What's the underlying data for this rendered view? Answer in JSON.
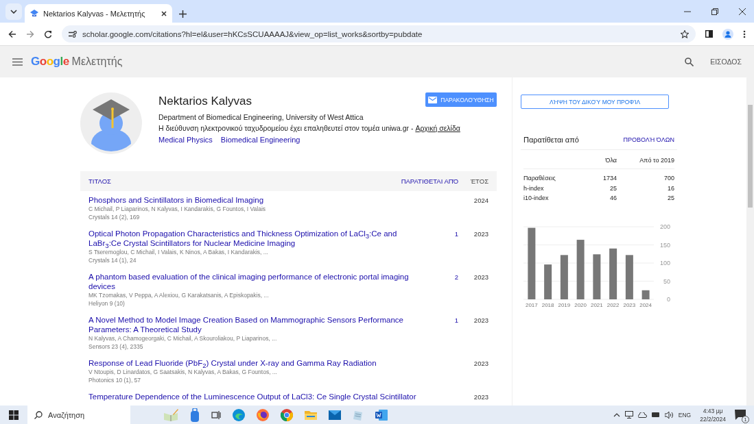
{
  "browser": {
    "tabs": [
      {
        "title": "Nektarios Kalyvas - Μελετητής",
        "selected": true
      }
    ],
    "url": "scholar.google.com/citations?hl=el&user=hKCsSCUAAAAJ&view_op=list_works&sortby=pubdate"
  },
  "header": {
    "logo": "Google",
    "product": "Μελετητής",
    "sign_in": "ΕΙΣΟΔΟΣ"
  },
  "profile": {
    "name": "Nektarios Kalyvas",
    "affiliation": "Department of Biomedical Engineering, University of West Attica",
    "email_note": "Η διεύθυνση ηλεκτρονικού ταχυδρομείου έχει επαληθευτεί στον τομέα uniwa.gr - ",
    "homepage_link": "Αρχική σελίδα",
    "interests": [
      "Medical Physics",
      "Biomedical Engineering"
    ],
    "follow_button": "ΠΑΡΑΚΟΛΟΎΘΗΣΗ"
  },
  "table": {
    "columns": [
      "ΤΙΤΛΟΣ",
      "ΠΑΡΑΤΙΘΕΤΑΙ ΑΠΌ",
      "ΈΤΟΣ"
    ],
    "rows": [
      {
        "title": "Phosphors and Scintillators in Biomedical Imaging",
        "authors": "C Michail, P Liaparinos, N Kalyvas, I Kandarakis, G Fountos, I Valais",
        "venue": "Crystals 14 (2), 169",
        "year": "2024"
      },
      {
        "title": "Optical Photon Propagation Characteristics and Thickness Optimization of LaCl$_{3}$:Ce and LaBr$_{3}$:Ce Crystal Scintillators for Nuclear Medicine Imaging",
        "authors": "S Tseremoglou, C Michail, I Valais, K Ninos, A Bakas, I Kandarakis, ...",
        "venue": "Crystals 14 (1), 24",
        "cited_by": "1",
        "year": "2023"
      },
      {
        "title": "A phantom based evaluation of the clinical imaging performance of electronic portal imaging devices",
        "authors": "MK Tzomakas, V Peppa, A Alexiou, G Karakatsanis, A Episkopakis, ...",
        "venue": "Heliyon 9 (10)",
        "cited_by": "2",
        "year": "2023"
      },
      {
        "title": "A Novel Method to Model Image Creation Based on Mammographic Sensors Performance Parameters: A Theoretical Study",
        "authors": "N Kalyvas, A Chamogeorgaki, C Michail, A Skouroliakou, P Liaparinos, ...",
        "venue": "Sensors 23 (4), 2335",
        "cited_by": "1",
        "year": "2023"
      },
      {
        "title": "Response of Lead Fluoride (PbF$_{2}$) Crystal under X-ray and Gamma Ray Radiation",
        "authors": "V Ntoupis, D Linardatos, G Saatsakis, N Kalyvas, A Bakas, G Fountos, ...",
        "venue": "Photonics 10 (1), 57",
        "year": "2023"
      },
      {
        "title": "Temperature Dependence of the Luminescence Output of LaCl3: Ce Single Crystal Scintillator",
        "year": "2023"
      }
    ]
  },
  "sidebar": {
    "get_profile_button": "ΛΉΨΗ ΤΟΥ ΔΙΚΟΎ ΜΟΥ ΠΡΟΦΊΛ",
    "cited_title": "Παρατίθεται από",
    "view_all": "ΠΡΟΒΟΛΉ ΌΛΩΝ",
    "columns": [
      "Όλα",
      "Από το 2019"
    ],
    "rows": [
      {
        "label": "Παραθέσεις",
        "all": "1734",
        "since": "700"
      },
      {
        "label": "h-index",
        "all": "25",
        "since": "16"
      },
      {
        "label": "i10-index",
        "all": "46",
        "since": "25"
      }
    ],
    "chart_data": {
      "type": "bar",
      "grid": true,
      "categories": [
        "2017",
        "2018",
        "2019",
        "2020",
        "2021",
        "2022",
        "2023",
        "2024"
      ],
      "values": [
        197,
        96,
        122,
        164,
        124,
        140,
        122,
        25
      ],
      "ylim": [
        0,
        200
      ],
      "yticks": [
        0,
        50,
        100,
        150,
        200
      ]
    }
  },
  "taskbar": {
    "search_placeholder": "Αναζήτηση",
    "language": "ENG",
    "time": "4:43 μμ",
    "date": "22/2/2024",
    "notification_count": "1"
  }
}
